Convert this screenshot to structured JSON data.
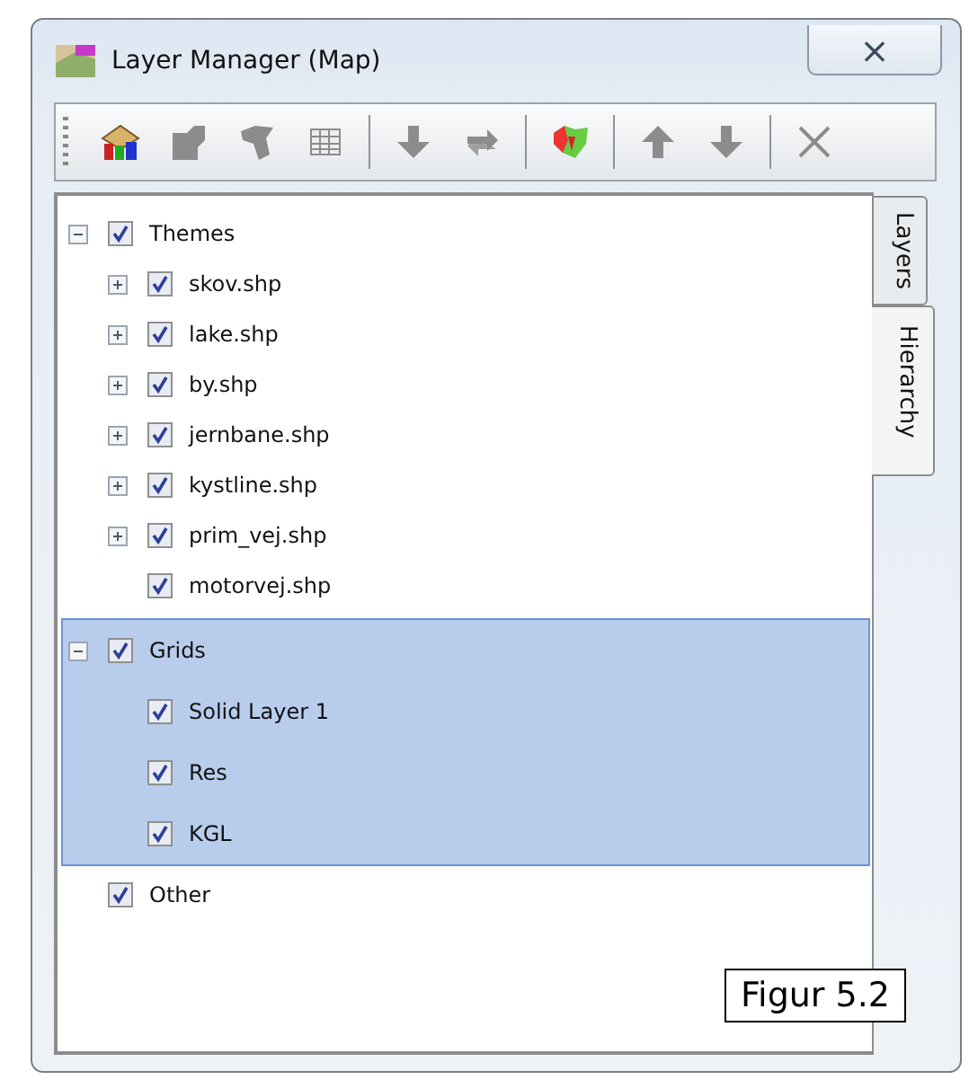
{
  "window": {
    "title": "Layer Manager (Map)",
    "close": "⨯"
  },
  "toolbar": [
    {
      "kind": "tool",
      "disabled": false
    },
    {
      "kind": "tool",
      "disabled": true
    },
    {
      "kind": "tool",
      "disabled": true
    },
    {
      "kind": "tool",
      "disabled": true
    },
    {
      "kind": "separator"
    },
    {
      "kind": "tool",
      "disabled": true
    },
    {
      "kind": "tool",
      "disabled": true
    },
    {
      "kind": "separator"
    },
    {
      "kind": "tool",
      "disabled": false
    },
    {
      "kind": "separator"
    },
    {
      "kind": "tool",
      "disabled": true
    },
    {
      "kind": "tool",
      "disabled": true
    },
    {
      "kind": "separator"
    },
    {
      "kind": "tool",
      "disabled": true
    }
  ],
  "tree": [
    {
      "label": "Themes",
      "checked": true,
      "expanded": true,
      "selected": false,
      "children": [
        {
          "label": "skov.shp",
          "checked": true,
          "expanded": false
        },
        {
          "label": "lake.shp",
          "checked": true,
          "expanded": false
        },
        {
          "label": "by.shp",
          "checked": true,
          "expanded": false
        },
        {
          "label": "jernbane.shp",
          "checked": true,
          "expanded": false
        },
        {
          "label": "kystline.shp",
          "checked": true,
          "expanded": false
        },
        {
          "label": "prim_vej.shp",
          "checked": true,
          "expanded": false
        },
        {
          "label": "motorvej.shp",
          "checked": true
        }
      ]
    },
    {
      "label": "Grids",
      "checked": true,
      "expanded": true,
      "selected": true,
      "children": [
        {
          "label": "Solid Layer 1",
          "checked": true
        },
        {
          "label": "Res",
          "checked": true
        },
        {
          "label": "KGL",
          "checked": true
        }
      ]
    },
    {
      "label": "Other",
      "checked": true,
      "selected": false
    }
  ],
  "tabs": [
    {
      "label": "Layers",
      "selected": false
    },
    {
      "label": "Hierarchy",
      "selected": true
    }
  ],
  "caption": "Figur 5.2"
}
